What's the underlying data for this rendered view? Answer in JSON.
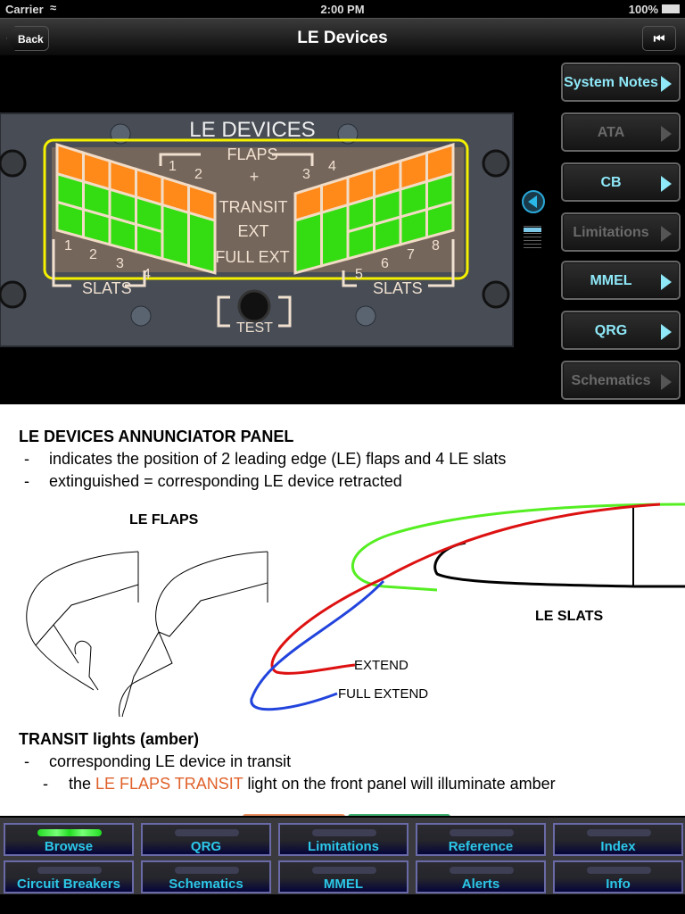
{
  "status": {
    "carrier": "Carrier",
    "time": "2:00 PM",
    "battery": "100%"
  },
  "nav": {
    "title": "LE Devices",
    "back": "Back",
    "rewind_icon": "skip-to-start-icon"
  },
  "panel": {
    "title": "LE DEVICES",
    "flaps": "FLAPS",
    "plus": "+",
    "transit": "TRANSIT",
    "ext": "EXT",
    "full_ext": "FULL EXT",
    "slats": "SLATS",
    "test": "TEST",
    "flap_nums": [
      "1",
      "2",
      "3",
      "4"
    ],
    "slat_nums": [
      "1",
      "2",
      "3",
      "4",
      "5",
      "6",
      "7",
      "8"
    ],
    "left_columns": [
      [
        "transit",
        "ext",
        "full_ext"
      ],
      [
        "transit",
        "ext",
        "full_ext"
      ],
      [
        "transit",
        "ext",
        "full_ext"
      ],
      [
        "transit",
        "ext",
        "full_ext"
      ],
      [
        "transit",
        "full_ext"
      ],
      [
        "transit",
        "full_ext"
      ]
    ],
    "right_columns": [
      [
        "transit",
        "full_ext"
      ],
      [
        "transit",
        "full_ext"
      ],
      [
        "transit",
        "ext",
        "full_ext"
      ],
      [
        "transit",
        "ext",
        "full_ext"
      ],
      [
        "transit",
        "ext",
        "full_ext"
      ],
      [
        "transit",
        "ext",
        "full_ext"
      ]
    ],
    "colors": {
      "transit": "#ff8a1a",
      "ext": "#33dd11",
      "full_ext": "#33dd11",
      "highlight": "#ffff00"
    }
  },
  "side_menu": [
    {
      "label": "System Notes",
      "enabled": true
    },
    {
      "label": "ATA",
      "enabled": false
    },
    {
      "label": "CB",
      "enabled": true
    },
    {
      "label": "Limitations",
      "enabled": false
    },
    {
      "label": "MMEL",
      "enabled": true
    },
    {
      "label": "QRG",
      "enabled": true
    },
    {
      "label": "Schematics",
      "enabled": false
    }
  ],
  "content": {
    "heading1": "LE DEVICES ANNUNCIATOR PANEL",
    "bullet1": "indicates the position of 2 leading edge (LE) flaps and  4 LE slats",
    "bullet2": "extinguished = corresponding LE device retracted",
    "dash": "-",
    "le_flaps": "LE FLAPS",
    "le_slats": "LE SLATS",
    "extend": "EXTEND",
    "full_extend": "FULL EXTEND",
    "heading2": "TRANSIT lights (amber)",
    "bullet3": "corresponding LE device in transit",
    "sub_pre": "the ",
    "sub_highlight": "LE FLAPS TRANSIT",
    "sub_post": " light on the front panel will illuminate amber",
    "highlight_color": "#e0602a"
  },
  "tabs": [
    {
      "label": "Browse",
      "active": true
    },
    {
      "label": "QRG"
    },
    {
      "label": "Limitations"
    },
    {
      "label": "Reference"
    },
    {
      "label": "Index"
    },
    {
      "label": "Circuit Breakers"
    },
    {
      "label": "Schematics"
    },
    {
      "label": "MMEL"
    },
    {
      "label": "Alerts"
    },
    {
      "label": "Info"
    }
  ]
}
